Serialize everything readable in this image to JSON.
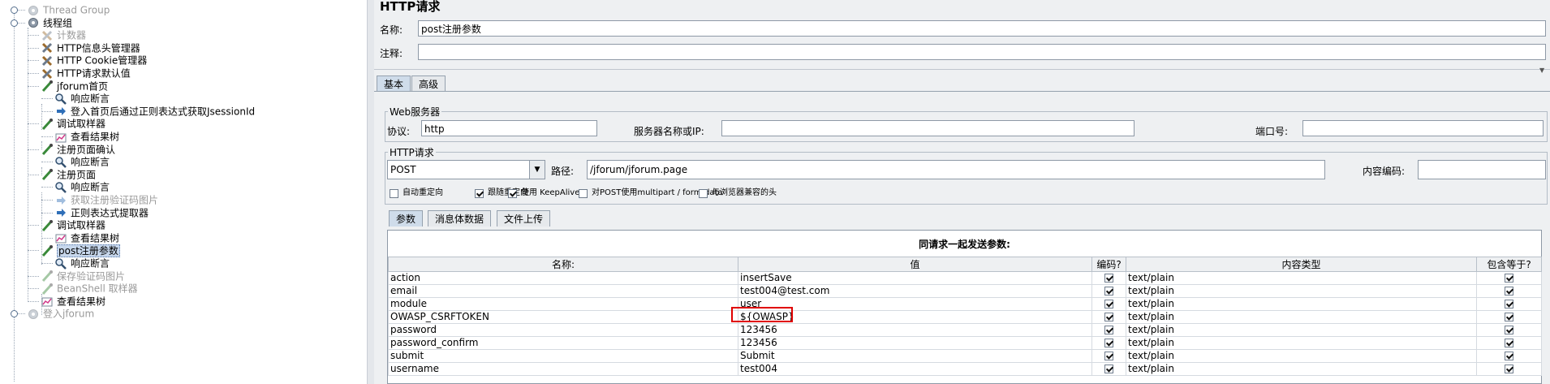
{
  "tree": [
    {
      "label": "Thread Group",
      "icon": "gear-icon",
      "indent": 1,
      "disabled": true
    },
    {
      "label": "线程组",
      "icon": "gear-icon",
      "indent": 1,
      "disabled": false
    },
    {
      "label": "计数器",
      "icon": "wrench-icon",
      "indent": 2,
      "disabled": true
    },
    {
      "label": "HTTP信息头管理器",
      "icon": "wrench-icon",
      "indent": 2,
      "disabled": false
    },
    {
      "label": "HTTP Cookie管理器",
      "icon": "wrench-icon",
      "indent": 2,
      "disabled": false
    },
    {
      "label": "HTTP请求默认值",
      "icon": "wrench-icon",
      "indent": 2,
      "disabled": false
    },
    {
      "label": "jforum首页",
      "icon": "pipette-icon",
      "indent": 2,
      "disabled": false
    },
    {
      "label": "响应断言",
      "icon": "magnifier-icon",
      "indent": 3,
      "disabled": false
    },
    {
      "label": "登入首页后通过正则表达式获取JsessionId",
      "icon": "arrow-icon",
      "indent": 3,
      "disabled": false
    },
    {
      "label": "调试取样器",
      "icon": "pipette-icon",
      "indent": 2,
      "disabled": false
    },
    {
      "label": "查看结果树",
      "icon": "chart-icon",
      "indent": 3,
      "disabled": false
    },
    {
      "label": "注册页面确认",
      "icon": "pipette-icon",
      "indent": 2,
      "disabled": false
    },
    {
      "label": "响应断言",
      "icon": "magnifier-icon",
      "indent": 3,
      "disabled": false
    },
    {
      "label": "注册页面",
      "icon": "pipette-icon",
      "indent": 2,
      "disabled": false
    },
    {
      "label": "响应断言",
      "icon": "magnifier-icon",
      "indent": 3,
      "disabled": false
    },
    {
      "label": "获取注册验证码图片",
      "icon": "arrow-icon",
      "indent": 3,
      "disabled": true
    },
    {
      "label": "正则表达式提取器",
      "icon": "arrow-icon",
      "indent": 3,
      "disabled": false
    },
    {
      "label": "调试取样器",
      "icon": "pipette-icon",
      "indent": 2,
      "disabled": false
    },
    {
      "label": "查看结果树",
      "icon": "chart-icon",
      "indent": 3,
      "disabled": false
    },
    {
      "label": "post注册参数",
      "icon": "pipette-icon",
      "indent": 2,
      "disabled": false,
      "selected": true
    },
    {
      "label": "响应断言",
      "icon": "magnifier-icon",
      "indent": 3,
      "disabled": false
    },
    {
      "label": "保存验证码图片",
      "icon": "pipette-icon",
      "indent": 2,
      "disabled": true
    },
    {
      "label": "BeanShell 取样器",
      "icon": "pipette-icon",
      "indent": 2,
      "disabled": true
    },
    {
      "label": "查看结果树",
      "icon": "chart-icon",
      "indent": 2,
      "disabled": false
    },
    {
      "label": "登入jforum",
      "icon": "gear-icon",
      "indent": 1,
      "disabled": true
    }
  ],
  "panel": {
    "title": "HTTP请求",
    "name_label": "名称:",
    "name_value": "post注册参数",
    "comment_label": "注释:",
    "comment_value": "",
    "tabs": [
      "基本",
      "高级"
    ],
    "web_server": {
      "legend": "Web服务器",
      "protocol_label": "协议:",
      "protocol_value": "http",
      "server_label": "服务器名称或IP:",
      "server_value": "",
      "port_label": "端口号:",
      "port_value": ""
    },
    "http_request": {
      "legend": "HTTP请求",
      "method": "POST",
      "path_label": "路径:",
      "path_value": "/jforum/jforum.page",
      "encoding_label": "内容编码:",
      "encoding_value": "",
      "options": [
        {
          "label": "自动重定向",
          "checked": false
        },
        {
          "label": "跟随重定向",
          "checked": true
        },
        {
          "label": "使用 KeepAlive",
          "checked": true
        },
        {
          "label": "对POST使用multipart / form-data",
          "checked": false
        },
        {
          "label": "与浏览器兼容的头",
          "checked": false
        }
      ]
    },
    "subtabs": [
      "参数",
      "消息体数据",
      "文件上传"
    ],
    "params_caption": "同请求一起发送参数:",
    "columns": [
      "名称:",
      "值",
      "编码?",
      "内容类型",
      "包含等于?"
    ],
    "rows": [
      {
        "name": "action",
        "value": "insertSave",
        "encode": true,
        "type": "text/plain",
        "include": true
      },
      {
        "name": "email",
        "value": "test004@test.com",
        "encode": true,
        "type": "text/plain",
        "include": true
      },
      {
        "name": "module",
        "value": "user",
        "encode": true,
        "type": "text/plain",
        "include": true
      },
      {
        "name": "OWASP_CSRFTOKEN",
        "value": "${OWASP}",
        "encode": true,
        "type": "text/plain",
        "include": true
      },
      {
        "name": "password",
        "value": "123456",
        "encode": true,
        "type": "text/plain",
        "include": true
      },
      {
        "name": "password_confirm",
        "value": "123456",
        "encode": true,
        "type": "text/plain",
        "include": true
      },
      {
        "name": "submit",
        "value": "Submit",
        "encode": true,
        "type": "text/plain",
        "include": true
      },
      {
        "name": "username",
        "value": "test004",
        "encode": true,
        "type": "text/plain",
        "include": true
      }
    ]
  }
}
